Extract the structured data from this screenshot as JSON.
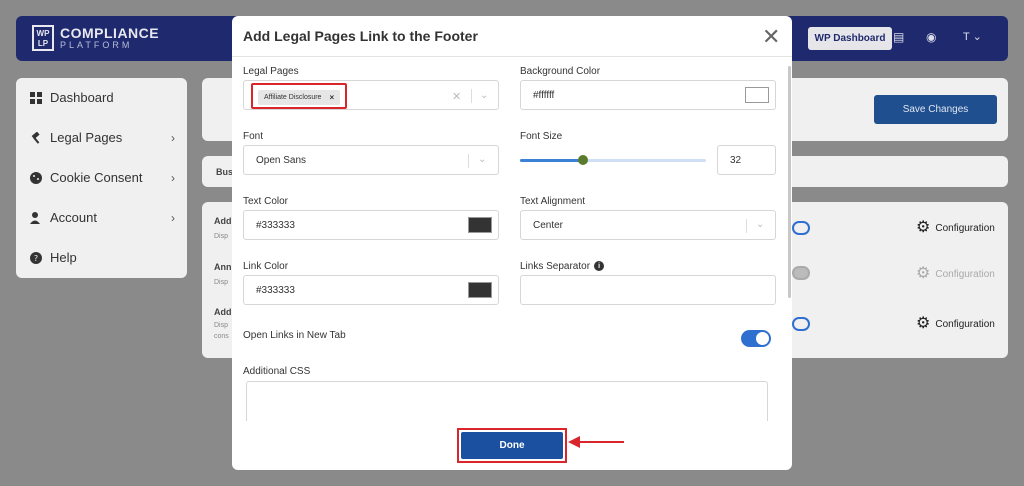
{
  "app": {
    "logo_mark": "WP\nLP",
    "logo_title": "COMPLIANCE",
    "logo_subtitle": "PLATFORM",
    "wp_dashboard_label": "WP Dashboard",
    "user_initial": "T"
  },
  "sidebar": {
    "items": [
      {
        "label": "Dashboard",
        "icon": "grid-icon",
        "has_chevron": false
      },
      {
        "label": "Legal Pages",
        "icon": "gavel-icon",
        "has_chevron": true
      },
      {
        "label": "Cookie Consent",
        "icon": "cookie-icon",
        "has_chevron": true
      },
      {
        "label": "Account",
        "icon": "user-gear-icon",
        "has_chevron": true
      },
      {
        "label": "Help",
        "icon": "help-icon",
        "has_chevron": false
      }
    ]
  },
  "background": {
    "save_changes_label": "Save Changes",
    "tab_fragment": "Bus",
    "rows": [
      {
        "title": "Add",
        "desc": "Disp",
        "config_label": "Configuration",
        "enabled": true
      },
      {
        "title": "Ann",
        "desc": "Disp",
        "config_label": "Configuration",
        "enabled": false
      },
      {
        "title": "Add",
        "desc": "Disp",
        "desc2": "cons",
        "config_label": "Configuration",
        "enabled": true
      }
    ]
  },
  "modal": {
    "title": "Add Legal Pages Link to the Footer",
    "legal_pages": {
      "label": "Legal Pages",
      "selected": [
        "Affiliate Disclosure"
      ]
    },
    "background_color": {
      "label": "Background Color",
      "value": "#ffffff",
      "swatch": "#ffffff"
    },
    "font": {
      "label": "Font",
      "value": "Open Sans"
    },
    "font_size": {
      "label": "Font Size",
      "value": "32",
      "slider_fraction": 0.34
    },
    "text_color": {
      "label": "Text Color",
      "value": "#333333",
      "swatch": "#333333"
    },
    "text_alignment": {
      "label": "Text Alignment",
      "value": "Center"
    },
    "link_color": {
      "label": "Link Color",
      "value": "#333333",
      "swatch": "#333333"
    },
    "links_separator": {
      "label": "Links Separator",
      "value": ""
    },
    "open_links_new_tab": {
      "label": "Open Links in New Tab",
      "enabled": true
    },
    "additional_css": {
      "label": "Additional CSS",
      "value": ""
    },
    "done_label": "Done"
  },
  "colors": {
    "accent": "#1b4fa0",
    "highlight": "#d9262b",
    "topbar": "#1f2a6e",
    "toggle_on": "#2e6fd0"
  }
}
